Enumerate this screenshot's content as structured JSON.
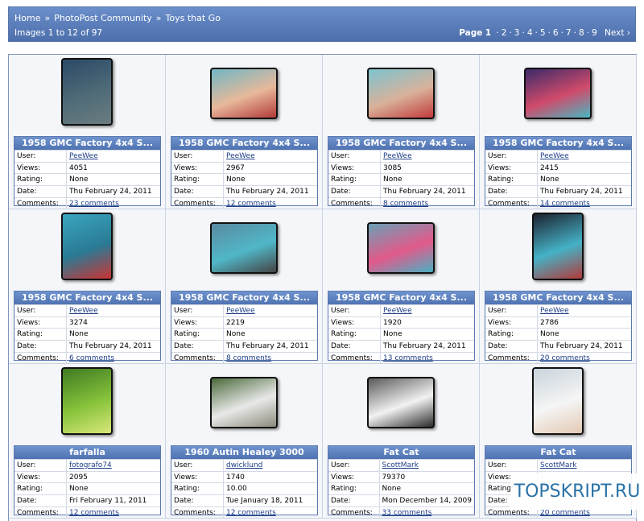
{
  "breadcrumb": {
    "home": "Home",
    "community": "PhotoPost Community",
    "category": "Toys that Go",
    "separator": "»"
  },
  "image_count": "Images 1 to 12 of 97",
  "pagination": {
    "label": "Page",
    "current": "1",
    "pages": [
      "2",
      "3",
      "4",
      "5",
      "6",
      "7",
      "8",
      "9"
    ],
    "next": "Next ›"
  },
  "field_labels": {
    "user": "User:",
    "views": "Views:",
    "rating": "Rating:",
    "date": "Date:",
    "comments": "Comments:"
  },
  "images": [
    {
      "title": "1958 GMC Factory 4x4 S...",
      "user": "PeeWee",
      "views": "4051",
      "rating": "None",
      "date": "Thu February 24, 2011",
      "comments": "23 comments",
      "thumb": "truck-front-photo",
      "colors": [
        "#2a4a66",
        "#4f6b78",
        "#6b7d80"
      ]
    },
    {
      "title": "1958 GMC Factory 4x4 S...",
      "user": "PeeWee",
      "views": "2967",
      "rating": "None",
      "date": "Thu February 24, 2011",
      "comments": "12 comments",
      "thumb": "pinup-girls-photo",
      "colors": [
        "#6fb7c4",
        "#e8b89a",
        "#b23a3a"
      ]
    },
    {
      "title": "1958 GMC Factory 4x4 S...",
      "user": "PeeWee",
      "views": "3085",
      "rating": "None",
      "date": "Thu February 24, 2011",
      "comments": "8 comments",
      "thumb": "pinup-girls-photo",
      "colors": [
        "#7cc4d0",
        "#d9b19a",
        "#c23b3b"
      ]
    },
    {
      "title": "1958 GMC Factory 4x4 S...",
      "user": "PeeWee",
      "views": "2415",
      "rating": "None",
      "date": "Thu February 24, 2011",
      "comments": "14 comments",
      "thumb": "truck-sunset-photo",
      "colors": [
        "#3b2b6b",
        "#d04a6a",
        "#4ab7c2"
      ]
    },
    {
      "title": "1958 GMC Factory 4x4 S...",
      "user": "PeeWee",
      "views": "3274",
      "rating": "None",
      "date": "Thu February 24, 2011",
      "comments": "6 comments",
      "thumb": "truck-girl-photo",
      "colors": [
        "#3aa6c0",
        "#2a7a94",
        "#c33"
      ]
    },
    {
      "title": "1958 GMC Factory 4x4 S...",
      "user": "PeeWee",
      "views": "2219",
      "rating": "None",
      "date": "Thu February 24, 2011",
      "comments": "8 comments",
      "thumb": "truck-group-photo",
      "colors": [
        "#5a8aa0",
        "#50b7c8",
        "#444"
      ]
    },
    {
      "title": "1958 GMC Factory 4x4 S...",
      "user": "PeeWee",
      "views": "1920",
      "rating": "None",
      "date": "Thu February 24, 2011",
      "comments": "13 comments",
      "thumb": "truck-group-photo",
      "colors": [
        "#6aa0b5",
        "#e25a8a",
        "#49b0c3"
      ]
    },
    {
      "title": "1958 GMC Factory 4x4 S...",
      "user": "PeeWee",
      "views": "2786",
      "rating": "None",
      "date": "Thu February 24, 2011",
      "comments": "20 comments",
      "thumb": "truck-girl-photo",
      "colors": [
        "#1c2230",
        "#45b2c6",
        "#b23a3a"
      ]
    },
    {
      "title": "farfalla",
      "user": "fotografo74",
      "views": "2095",
      "rating": "None",
      "date": "Fri February 11, 2011",
      "comments": "12 comments",
      "thumb": "caterpillar-photo",
      "colors": [
        "#3f7a22",
        "#86c23a",
        "#d9e87a"
      ]
    },
    {
      "title": "1960 Autin Healey 3000",
      "user": "dwicklund",
      "views": "1740",
      "rating": "10.00",
      "date": "Tue January 18, 2011",
      "comments": "12 comments",
      "thumb": "white-car-photo",
      "colors": [
        "#4a6a3a",
        "#e9e9e9",
        "#8a8a7a"
      ]
    },
    {
      "title": "Fat Cat",
      "user": "ScottMark",
      "views": "79370",
      "rating": "None",
      "date": "Mon December 14, 2009",
      "comments": "33 comments",
      "thumb": "fat-cat-photo",
      "colors": [
        "#5a5a5a",
        "#f2f2f2",
        "#2b2b2b"
      ]
    },
    {
      "title": "Fat Cat",
      "user": "ScottMark",
      "views": "",
      "rating": "",
      "date": "",
      "comments": "20 comments",
      "thumb": "white-cat-photo",
      "colors": [
        "#c9d4dc",
        "#f5f5f5",
        "#e3c9b3"
      ]
    }
  ],
  "watermark": "TOPSKRIPT.RU"
}
